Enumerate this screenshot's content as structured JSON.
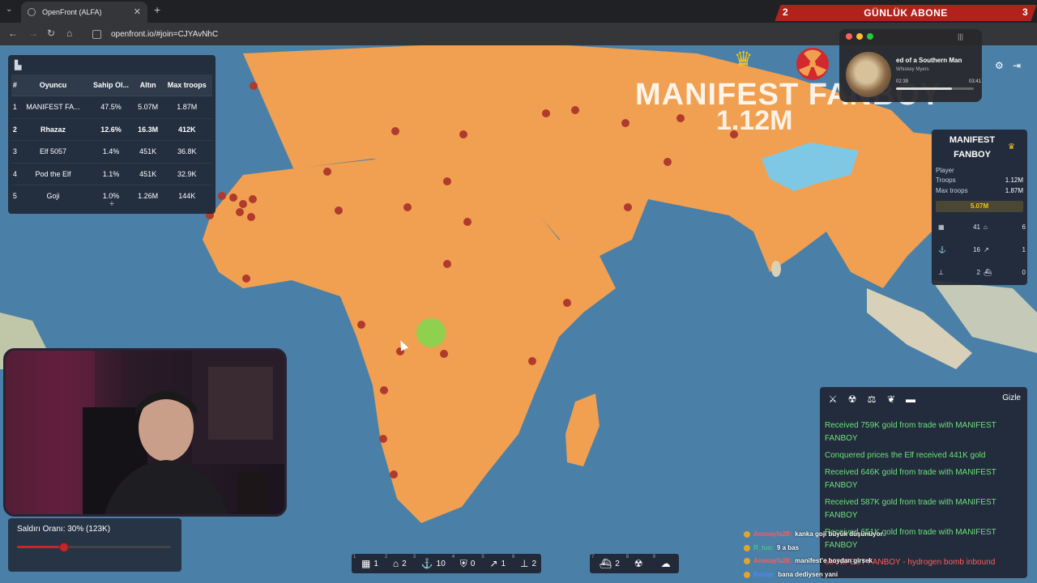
{
  "browser": {
    "tab_title": "OpenFront (ALFA)",
    "url": "openfront.io/#join=CJYAvNhC"
  },
  "subscribe_banner": {
    "left_count": "2",
    "label": "GÜNLÜK ABONE",
    "right_count": "3"
  },
  "leaderboard": {
    "headers": [
      "#",
      "Oyuncu",
      "Sahip Ol...",
      "Altın",
      "Max troops"
    ],
    "rows": [
      {
        "rank": "1",
        "name": "MANIFEST FA...",
        "owned": "47.5%",
        "gold": "5.07M",
        "max_troops": "1.87M",
        "highlight": false
      },
      {
        "rank": "2",
        "name": "Rhazaz",
        "owned": "12.6%",
        "gold": "16.3M",
        "max_troops": "412K",
        "highlight": true
      },
      {
        "rank": "3",
        "name": "Elf 5057",
        "owned": "1.4%",
        "gold": "451K",
        "max_troops": "36.8K",
        "highlight": false
      },
      {
        "rank": "4",
        "name": "Pod the Elf",
        "owned": "1.1%",
        "gold": "451K",
        "max_troops": "32.9K",
        "highlight": false
      },
      {
        "rank": "5",
        "name": "Goji",
        "owned": "1.0%",
        "gold": "1.26M",
        "max_troops": "144K",
        "highlight": false
      }
    ],
    "expand_label": "+"
  },
  "map_overlay": {
    "name": "MANIFEST FANBOY",
    "troops": "1.12M"
  },
  "player_card": {
    "name": "MANIFEST FANBOY",
    "type_label": "Player",
    "troops_label": "Troops",
    "troops_value": "1.12M",
    "max_troops_label": "Max troops",
    "max_troops_value": "1.87M",
    "gold": "5.07M",
    "stats": [
      {
        "icon": "city-icon",
        "value": "41"
      },
      {
        "icon": "factory-icon",
        "value": "6"
      },
      {
        "icon": "port-icon",
        "value": "16"
      },
      {
        "icon": "missile-icon",
        "value": "1"
      },
      {
        "icon": "sam-icon",
        "value": "2"
      },
      {
        "icon": "warship-icon",
        "value": "0"
      }
    ]
  },
  "music_widget": {
    "title": "ed of a Southern Man",
    "artist": "Whiskey Myers",
    "elapsed": "02:39",
    "duration": "03:41",
    "progress": 0.72
  },
  "attack": {
    "label": "Saldırı Oranı: 30% (123K)",
    "ratio": 0.3
  },
  "events": {
    "hide_label": "Gizle",
    "items": [
      {
        "text": "Received 759K gold from trade with MANIFEST FANBOY",
        "tone": "green"
      },
      {
        "text": "Conquered prices the Elf received 441K gold",
        "tone": "green"
      },
      {
        "text": "Received 646K gold from trade with MANIFEST FANBOY",
        "tone": "green"
      },
      {
        "text": "Received 587K gold from trade with MANIFEST FANBOY",
        "tone": "green"
      },
      {
        "text": "Received 651K gold from trade with MANIFEST FANBOY",
        "tone": "green"
      },
      {
        "text": "MANIFEST FANBOY - hydrogen bomb inbound",
        "tone": "red"
      }
    ]
  },
  "chat": [
    {
      "user": "Anasayfa28:",
      "message": "kanka goji büyük düşünüyor",
      "color": "red"
    },
    {
      "user": "R_tus:",
      "message": "9 a bas",
      "color": "green"
    },
    {
      "user": "Anasayfa28:",
      "message": "manifest'e boydan girsek",
      "color": "red"
    },
    {
      "user": "Kuzey:",
      "message": "bana dediysen yani",
      "color": "blue"
    }
  ],
  "build_bar": [
    {
      "key": "1",
      "icon": "city-icon",
      "glyph": "▦",
      "count": "1"
    },
    {
      "key": "2",
      "icon": "factory-icon",
      "glyph": "⌂",
      "count": "2"
    },
    {
      "key": "3",
      "icon": "port-icon",
      "glyph": "⚓",
      "count": "10"
    },
    {
      "key": "4",
      "icon": "defense-icon",
      "glyph": "⛨",
      "count": "0"
    },
    {
      "key": "5",
      "icon": "missile-icon",
      "glyph": "↗",
      "count": "1"
    },
    {
      "key": "6",
      "icon": "sam-icon",
      "glyph": "⊥",
      "count": "2"
    }
  ],
  "build_bar_2": [
    {
      "key": "7",
      "icon": "warship-icon",
      "glyph": "⛴",
      "count": "2"
    },
    {
      "key": "8",
      "icon": "atom-bomb-icon",
      "glyph": "☢",
      "count": ""
    },
    {
      "key": "9",
      "icon": "hydrogen-bomb-icon",
      "glyph": "☁",
      "count": ""
    }
  ],
  "colors": {
    "ocean": "#4a7fa8",
    "player_territory": "#f0a050",
    "ally_territory": "#7ec8e6",
    "enemy_territory": "#8fd14f",
    "city_marker": "#b03a2e"
  }
}
